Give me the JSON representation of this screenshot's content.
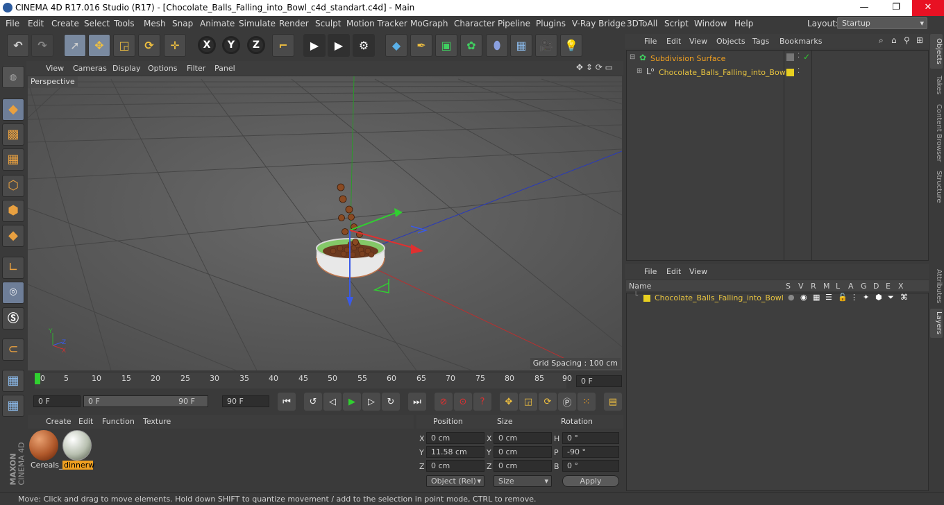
{
  "window": {
    "title": "CINEMA 4D R17.016 Studio (R17) - [Chocolate_Balls_Falling_into_Bowl_c4d_standart.c4d] - Main",
    "minimize": "—",
    "maximize": "❐",
    "close": "✕"
  },
  "menubar": {
    "items": [
      "File",
      "Edit",
      "Create",
      "Select",
      "Tools",
      "Mesh",
      "Snap",
      "Animate",
      "Simulate",
      "Render",
      "Sculpt",
      "Motion Tracker",
      "MoGraph",
      "Character",
      "Pipeline",
      "Plugins",
      "V-Ray Bridge",
      "3DToAll",
      "Script",
      "Window",
      "Help"
    ],
    "layout_label": "Layout:",
    "layout_value": "Startup"
  },
  "toolbar": {
    "axis_x": "X",
    "axis_y": "Y",
    "axis_z": "Z"
  },
  "viewport": {
    "menu": [
      "View",
      "Cameras",
      "Display",
      "Options",
      "Filter",
      "Panel"
    ],
    "label": "Perspective",
    "grid_spacing": "Grid Spacing : 100 cm"
  },
  "timeline": {
    "ticks": [
      "0",
      "5",
      "10",
      "15",
      "20",
      "25",
      "30",
      "35",
      "40",
      "45",
      "50",
      "55",
      "60",
      "65",
      "70",
      "75",
      "80",
      "85",
      "90"
    ],
    "current_frame": "0 F"
  },
  "playback": {
    "start": "0 F",
    "range_start": "0 F",
    "range_end": "90 F",
    "end": "90 F"
  },
  "materials": {
    "menu": [
      "Create",
      "Edit",
      "Function",
      "Texture"
    ],
    "items": [
      {
        "name": "Cereals_",
        "color": "#b0582a"
      },
      {
        "name": "dinnerw",
        "color": "#b8c0b0"
      }
    ]
  },
  "coordinates": {
    "headers": [
      "Position",
      "Size",
      "Rotation"
    ],
    "rows": [
      {
        "axis": "X",
        "pos": "0 cm",
        "size_axis": "X",
        "size": "0 cm",
        "rot_axis": "H",
        "rot": "0 °"
      },
      {
        "axis": "Y",
        "pos": "11.58 cm",
        "size_axis": "Y",
        "size": "0 cm",
        "rot_axis": "P",
        "rot": "-90 °"
      },
      {
        "axis": "Z",
        "pos": "0 cm",
        "size_axis": "Z",
        "size": "0 cm",
        "rot_axis": "B",
        "rot": "0 °"
      }
    ],
    "mode": "Object (Rel)",
    "size_mode": "Size",
    "apply": "Apply"
  },
  "objects": {
    "menu": [
      "File",
      "Edit",
      "View",
      "Objects",
      "Tags",
      "Bookmarks"
    ],
    "items": [
      {
        "name": "Subdivision Surface",
        "color": "#f0a020"
      },
      {
        "name": "Chocolate_Balls_Falling_into_Bowl",
        "color": "#e8c440"
      }
    ]
  },
  "layers": {
    "menu": [
      "File",
      "Edit",
      "View"
    ],
    "col_name": "Name",
    "col_flags": [
      "S",
      "V",
      "R",
      "M",
      "L",
      "A",
      "G",
      "D",
      "E",
      "X"
    ],
    "items": [
      {
        "name": "Chocolate_Balls_Falling_into_Bowl",
        "color": "#e8c440"
      }
    ]
  },
  "right_tabs": {
    "top": [
      "Objects",
      "Takes",
      "Content Browser",
      "Structure"
    ],
    "bottom": [
      "Attributes",
      "Layers"
    ]
  },
  "brand": {
    "line1": "MAXON",
    "line2": "CINEMA 4D"
  },
  "status": {
    "text": "Move: Click and drag to move elements. Hold down SHIFT to quantize movement / add to the selection in point mode, CTRL to remove."
  },
  "colors": {
    "axis_x": "#e02020",
    "axis_y": "#20c020",
    "axis_z": "#2040e0",
    "accent": "#f0a020"
  }
}
